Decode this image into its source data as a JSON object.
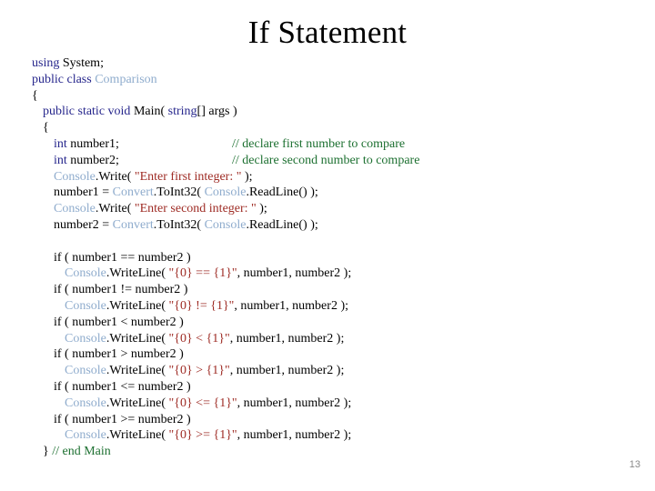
{
  "slide": {
    "title": "If Statement",
    "page_number": "13",
    "colors": {
      "background": "#ffffff",
      "title_text": "#000000",
      "keyword": "#26268c",
      "type_name": "#8faccd",
      "string": "#9e2b24",
      "comment": "#1d7031",
      "plain_text": "#000000",
      "page_number": "#8a8a8a"
    }
  },
  "code": {
    "language": "C#",
    "lines": [
      {
        "indent": 0,
        "tokens": [
          {
            "text": "using ",
            "kind": "keyword"
          },
          {
            "text": "System;",
            "kind": "plain"
          }
        ]
      },
      {
        "indent": 0,
        "tokens": [
          {
            "text": "public class ",
            "kind": "keyword"
          },
          {
            "text": "Comparison",
            "kind": "type"
          }
        ]
      },
      {
        "indent": 0,
        "tokens": [
          {
            "text": "{",
            "kind": "plain"
          }
        ]
      },
      {
        "indent": 1,
        "tokens": [
          {
            "text": "public static void ",
            "kind": "keyword"
          },
          {
            "text": "Main( ",
            "kind": "plain"
          },
          {
            "text": "string",
            "kind": "keyword"
          },
          {
            "text": "[] args )",
            "kind": "plain"
          }
        ]
      },
      {
        "indent": 1,
        "tokens": [
          {
            "text": "{",
            "kind": "plain"
          }
        ]
      },
      {
        "indent": 2,
        "tokens": [
          {
            "text": "int",
            "kind": "keyword"
          },
          {
            "text": " number1;",
            "kind": "plain"
          }
        ],
        "comment": "// declare first number to compare"
      },
      {
        "indent": 2,
        "tokens": [
          {
            "text": "int",
            "kind": "keyword"
          },
          {
            "text": " number2;",
            "kind": "plain"
          }
        ],
        "comment": "// declare second number to compare"
      },
      {
        "indent": 2,
        "tokens": [
          {
            "text": "Console",
            "kind": "type"
          },
          {
            "text": ".Write( ",
            "kind": "plain"
          },
          {
            "text": "\"Enter first integer: \"",
            "kind": "string"
          },
          {
            "text": " );",
            "kind": "plain"
          }
        ]
      },
      {
        "indent": 2,
        "tokens": [
          {
            "text": "number1 = ",
            "kind": "plain"
          },
          {
            "text": "Convert",
            "kind": "type"
          },
          {
            "text": ".ToInt32( ",
            "kind": "plain"
          },
          {
            "text": "Console",
            "kind": "type"
          },
          {
            "text": ".ReadLine() );",
            "kind": "plain"
          }
        ]
      },
      {
        "indent": 2,
        "tokens": [
          {
            "text": "Console",
            "kind": "type"
          },
          {
            "text": ".Write( ",
            "kind": "plain"
          },
          {
            "text": "\"Enter second integer: \"",
            "kind": "string"
          },
          {
            "text": " );",
            "kind": "plain"
          }
        ]
      },
      {
        "indent": 2,
        "tokens": [
          {
            "text": "number2 = ",
            "kind": "plain"
          },
          {
            "text": "Convert",
            "kind": "type"
          },
          {
            "text": ".ToInt32( ",
            "kind": "plain"
          },
          {
            "text": "Console",
            "kind": "type"
          },
          {
            "text": ".ReadLine() );",
            "kind": "plain"
          }
        ]
      },
      {
        "indent": 0,
        "blank": true,
        "tokens": []
      },
      {
        "indent": 2,
        "tokens": [
          {
            "text": "if ( number1 == number2 )",
            "kind": "plain"
          }
        ]
      },
      {
        "indent": 3,
        "tokens": [
          {
            "text": "Console",
            "kind": "type"
          },
          {
            "text": ".WriteLine( ",
            "kind": "plain"
          },
          {
            "text": "\"{0} == {1}\"",
            "kind": "string"
          },
          {
            "text": ", number1, number2 );",
            "kind": "plain"
          }
        ]
      },
      {
        "indent": 2,
        "tokens": [
          {
            "text": "if ( number1 != number2 )",
            "kind": "plain"
          }
        ]
      },
      {
        "indent": 3,
        "tokens": [
          {
            "text": "Console",
            "kind": "type"
          },
          {
            "text": ".WriteLine( ",
            "kind": "plain"
          },
          {
            "text": "\"{0} != {1}\"",
            "kind": "string"
          },
          {
            "text": ", number1, number2 );",
            "kind": "plain"
          }
        ]
      },
      {
        "indent": 2,
        "tokens": [
          {
            "text": "if ( number1 < number2 )",
            "kind": "plain"
          }
        ]
      },
      {
        "indent": 3,
        "tokens": [
          {
            "text": "Console",
            "kind": "type"
          },
          {
            "text": ".WriteLine( ",
            "kind": "plain"
          },
          {
            "text": "\"{0} < {1}\"",
            "kind": "string"
          },
          {
            "text": ", number1, number2 );",
            "kind": "plain"
          }
        ]
      },
      {
        "indent": 2,
        "tokens": [
          {
            "text": "if ( number1 > number2 )",
            "kind": "plain"
          }
        ]
      },
      {
        "indent": 3,
        "tokens": [
          {
            "text": "Console",
            "kind": "type"
          },
          {
            "text": ".WriteLine( ",
            "kind": "plain"
          },
          {
            "text": "\"{0} > {1}\"",
            "kind": "string"
          },
          {
            "text": ", number1, number2 );",
            "kind": "plain"
          }
        ]
      },
      {
        "indent": 2,
        "tokens": [
          {
            "text": "if ( number1 <= number2 )",
            "kind": "plain"
          }
        ]
      },
      {
        "indent": 3,
        "tokens": [
          {
            "text": "Console",
            "kind": "type"
          },
          {
            "text": ".WriteLine( ",
            "kind": "plain"
          },
          {
            "text": "\"{0} <= {1}\"",
            "kind": "string"
          },
          {
            "text": ", number1, number2 );",
            "kind": "plain"
          }
        ]
      },
      {
        "indent": 2,
        "tokens": [
          {
            "text": "if ( number1 >= number2 )",
            "kind": "plain"
          }
        ]
      },
      {
        "indent": 3,
        "tokens": [
          {
            "text": "Console",
            "kind": "type"
          },
          {
            "text": ".WriteLine( ",
            "kind": "plain"
          },
          {
            "text": "\"{0} >= {1}\"",
            "kind": "string"
          },
          {
            "text": ", number1, number2 );",
            "kind": "plain"
          }
        ]
      },
      {
        "indent": 1,
        "tokens": [
          {
            "text": "} ",
            "kind": "plain"
          },
          {
            "text": "// end Main",
            "kind": "comment"
          }
        ]
      }
    ]
  }
}
